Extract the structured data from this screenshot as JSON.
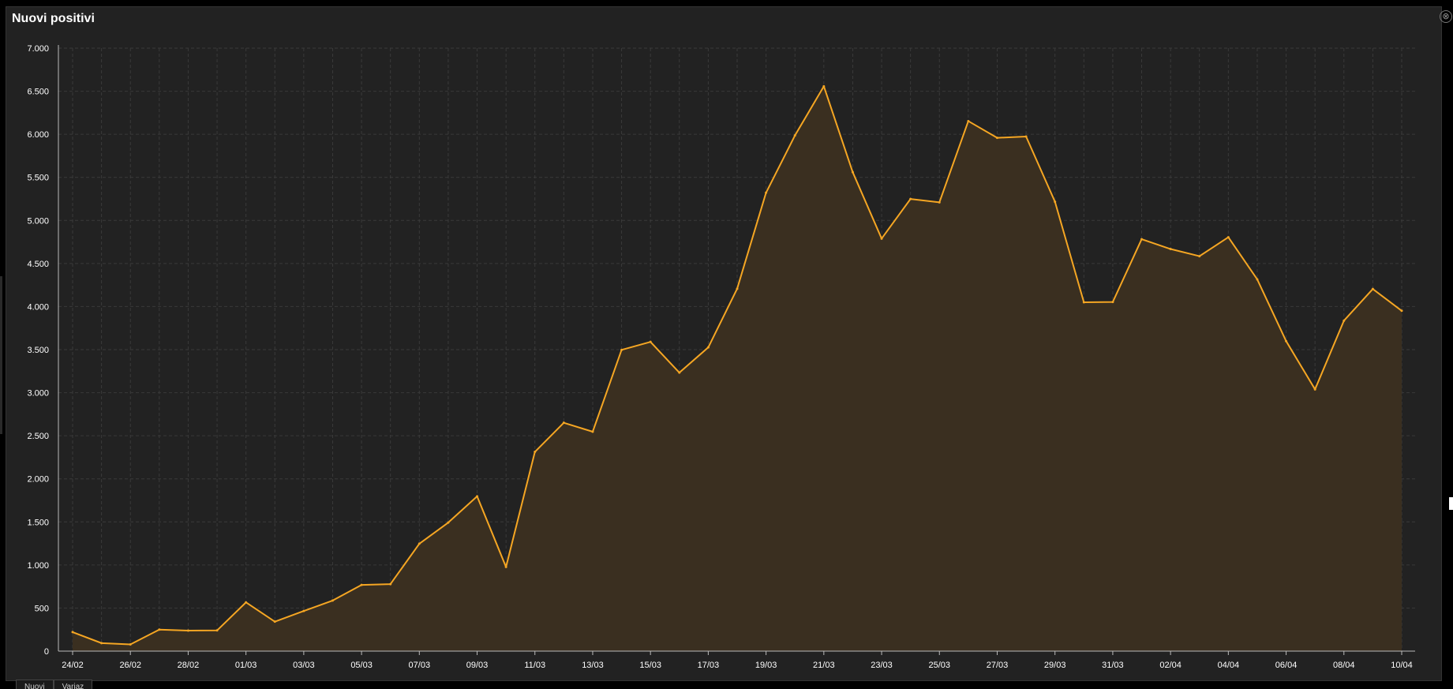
{
  "window": {
    "title": "Nuovi positivi",
    "close_icon": "⊗"
  },
  "tabs": [
    "Nuovi",
    "Variaz"
  ],
  "colors": {
    "line": "#f5a623",
    "fill": "#3a2f20",
    "grid": "#3a3a3a",
    "axis": "#bbbbbb",
    "text": "#ffffff"
  },
  "chart_data": {
    "type": "area",
    "title": "Nuovi positivi",
    "xlabel": "",
    "ylabel": "",
    "ylim": [
      0,
      7000
    ],
    "y_ticks": [
      0,
      500,
      1000,
      1500,
      2000,
      2500,
      3000,
      3500,
      4000,
      4500,
      5000,
      5500,
      6000,
      6500,
      7000
    ],
    "y_tick_labels": [
      "0",
      "500",
      "1.000",
      "1.500",
      "2.000",
      "2.500",
      "3.000",
      "3.500",
      "4.000",
      "4.500",
      "5.000",
      "5.500",
      "6.000",
      "6.500",
      "7.000"
    ],
    "x": [
      "24/02",
      "25/02",
      "26/02",
      "27/02",
      "28/02",
      "29/02",
      "01/03",
      "02/03",
      "03/03",
      "04/03",
      "05/03",
      "06/03",
      "07/03",
      "08/03",
      "09/03",
      "10/03",
      "11/03",
      "12/03",
      "13/03",
      "14/03",
      "15/03",
      "16/03",
      "17/03",
      "18/03",
      "19/03",
      "20/03",
      "21/03",
      "22/03",
      "23/03",
      "24/03",
      "25/03",
      "26/03",
      "27/03",
      "28/03",
      "29/03",
      "30/03",
      "31/03",
      "01/04",
      "02/04",
      "03/04",
      "04/04",
      "05/04",
      "06/04",
      "07/04",
      "08/04",
      "09/04",
      "10/04"
    ],
    "x_tick_labels": [
      "24/02",
      "26/02",
      "28/02",
      "01/03",
      "03/03",
      "05/03",
      "07/03",
      "09/03",
      "11/03",
      "13/03",
      "15/03",
      "17/03",
      "19/03",
      "21/03",
      "23/03",
      "25/03",
      "27/03",
      "29/03",
      "31/03",
      "02/04",
      "04/04",
      "06/04",
      "08/04",
      "10/04"
    ],
    "series": [
      {
        "values": [
          221,
          93,
          78,
          250,
          238,
          240,
          566,
          342,
          466,
          587,
          769,
          778,
          1247,
          1492,
          1797,
          977,
          2313,
          2651,
          2547,
          3497,
          3590,
          3233,
          3526,
          4207,
          5322,
          5986,
          6557,
          5560,
          4789,
          5249,
          5210,
          6153,
          5959,
          5974,
          5217,
          4050,
          4053,
          4782,
          4668,
          4585,
          4805,
          4316,
          3599,
          3039,
          3836,
          4204,
          3951
        ]
      }
    ],
    "grid": true,
    "legend": "none"
  }
}
